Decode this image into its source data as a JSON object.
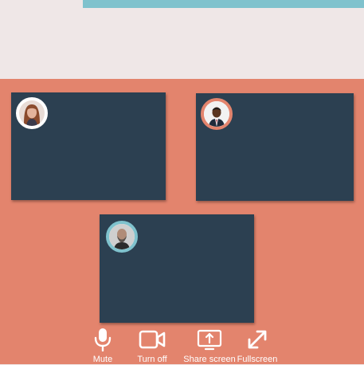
{
  "controls": {
    "mute_label": "Mute",
    "turn_off_label": "Turn off",
    "share_screen_label": "Share screen",
    "fullscreen_label": "Fullscreen"
  },
  "participants": [
    {
      "avatar": "woman-avatar",
      "ring_color": "#ffffff"
    },
    {
      "avatar": "man-suit-avatar",
      "ring_color": "#e3846d"
    },
    {
      "avatar": "bearded-man-avatar",
      "ring_color": "#7fc2cd"
    }
  ],
  "colors": {
    "background": "#efe7e7",
    "stage": "#e3846d",
    "tile": "#2c4051",
    "accent": "#7fc2cd"
  }
}
